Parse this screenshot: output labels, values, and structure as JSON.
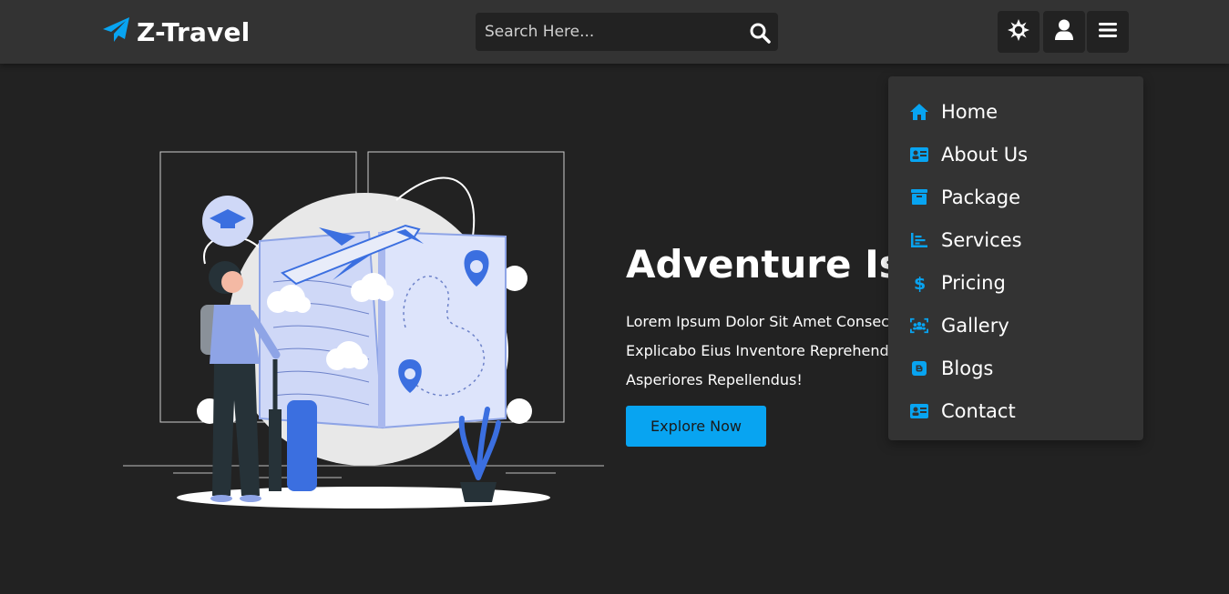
{
  "header": {
    "logo_text": "Z-Travel",
    "search_placeholder": "Search Here...",
    "icons": [
      "plane-icon",
      "search-icon",
      "sun-theme-icon",
      "user-icon",
      "menu-icon"
    ]
  },
  "nav": {
    "items": [
      {
        "label": "Home",
        "icon": "home-icon"
      },
      {
        "label": "About Us",
        "icon": "id-card-icon"
      },
      {
        "label": "Package",
        "icon": "archive-box-icon"
      },
      {
        "label": "Services",
        "icon": "chart-bars-icon"
      },
      {
        "label": "Pricing",
        "icon": "dollar-icon"
      },
      {
        "label": "Gallery",
        "icon": "users-group-icon"
      },
      {
        "label": "Blogs",
        "icon": "blogger-icon"
      },
      {
        "label": "Contact",
        "icon": "contact-card-icon"
      }
    ]
  },
  "hero": {
    "title": "Adventure Is W",
    "lines": [
      "Lorem Ipsum Dolor Sit Amet Consect",
      "Explicabo Eius Inventore Reprehende",
      "Asperiores Repellendus!"
    ],
    "button_label": "Explore Now"
  },
  "colors": {
    "background": "#222222",
    "header": "#333333",
    "accent": "#08a4f1",
    "illustration_blue": "#3b6fe0"
  }
}
